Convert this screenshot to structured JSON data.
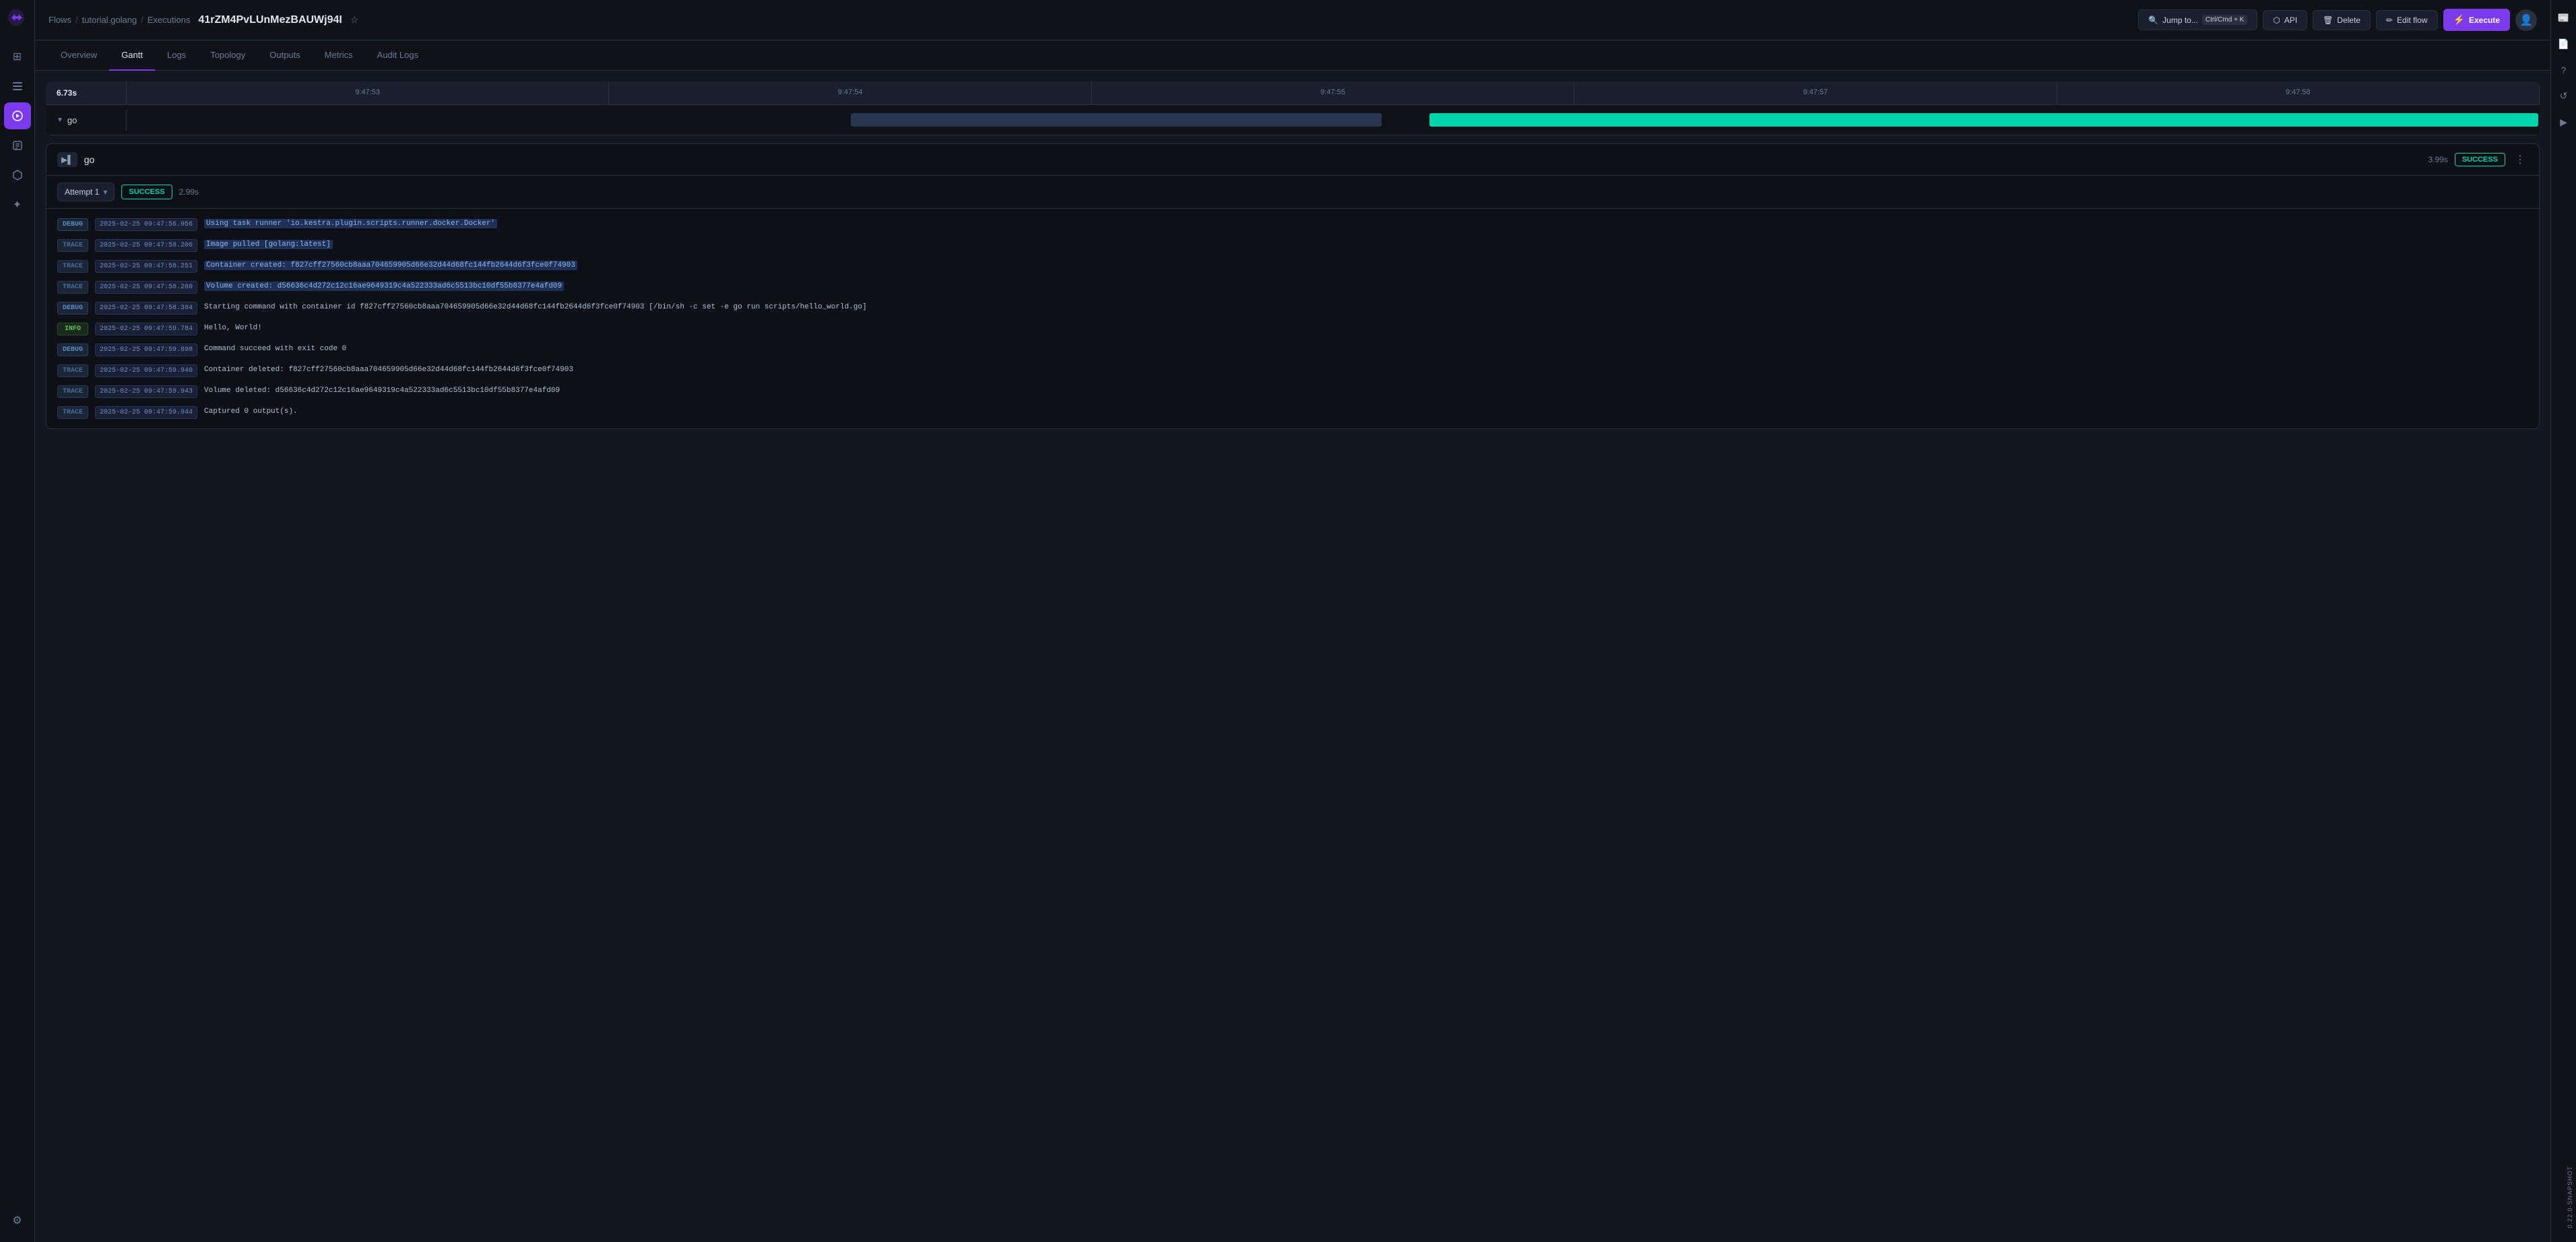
{
  "sidebar": {
    "logo_alt": "Kestra",
    "items": [
      {
        "id": "dashboard",
        "icon": "⊞",
        "label": "Dashboard"
      },
      {
        "id": "flows",
        "icon": "≡",
        "label": "Flows"
      },
      {
        "id": "executions",
        "icon": "▶",
        "label": "Executions",
        "active": true
      },
      {
        "id": "logs",
        "icon": "≣",
        "label": "Logs"
      },
      {
        "id": "plugins",
        "icon": "⬡",
        "label": "Plugins"
      },
      {
        "id": "integrations",
        "icon": "✦",
        "label": "Integrations"
      },
      {
        "id": "settings",
        "icon": "⚙",
        "label": "Settings"
      }
    ]
  },
  "header": {
    "breadcrumb": [
      "Flows",
      "tutorial.golang",
      "Executions"
    ],
    "flow_id": "41rZM4PvLUnMezBAUWj94I",
    "actions": {
      "jump_to": "Jump to...",
      "shortcut": "Ctrl/Cmd + K",
      "api": "API",
      "delete": "Delete",
      "edit_flow": "Edit flow",
      "execute": "Execute"
    }
  },
  "nav_tabs": [
    {
      "id": "overview",
      "label": "Overview"
    },
    {
      "id": "gantt",
      "label": "Gantt",
      "active": true
    },
    {
      "id": "logs",
      "label": "Logs"
    },
    {
      "id": "topology",
      "label": "Topology"
    },
    {
      "id": "outputs",
      "label": "Outputs"
    },
    {
      "id": "metrics",
      "label": "Metrics"
    },
    {
      "id": "audit_logs",
      "label": "Audit Logs"
    }
  ],
  "gantt": {
    "label_col": "6.73s",
    "time_markers": [
      "9:47:53",
      "9:47:54",
      "9:47:55",
      "9:47:57",
      "9:47:58"
    ],
    "row_label": "go"
  },
  "task": {
    "name": "go",
    "icon": "▶▌",
    "duration": "3.99s",
    "status": "SUCCESS",
    "attempt": {
      "label": "Attempt 1",
      "status": "SUCCESS",
      "duration": "2.99s"
    }
  },
  "logs": [
    {
      "level": "DEBUG",
      "level_class": "badge-debug",
      "timestamp": "2025-02-25 09:47:56.956",
      "message": "Using task runner 'io.kestra.plugin.scripts.runner.docker.Docker'",
      "highlighted": true
    },
    {
      "level": "TRACE",
      "level_class": "badge-trace",
      "timestamp": "2025-02-25 09:47:58.206",
      "message": "Image pulled [golang:latest]",
      "highlighted": true
    },
    {
      "level": "TRACE",
      "level_class": "badge-trace",
      "timestamp": "2025-02-25 09:47:58.251",
      "message": "Container created: f827cff27560cb8aaa704659905d66e32d44d68fc144fb2644d6f3fce0f74903",
      "highlighted": true
    },
    {
      "level": "TRACE",
      "level_class": "badge-trace",
      "timestamp": "2025-02-25 09:47:58.260",
      "message": "Volume created: d56636c4d272c12c16ae9649319c4a522333ad6c5513bc10df55b8377e4afd09",
      "highlighted": true
    },
    {
      "level": "DEBUG",
      "level_class": "badge-debug",
      "timestamp": "2025-02-25 09:47:58.384",
      "message": "Starting command with container id f827cff27560cb8aaa704659905d66e32d44d68fc144fb2644d6f3fce0f74903 [/bin/sh -c set -e\ngo run scripts/hello_world.go]",
      "highlighted": false
    },
    {
      "level": "INFO",
      "level_class": "badge-info",
      "timestamp": "2025-02-25 09:47:59.784",
      "message": "Hello, World!",
      "highlighted": false
    },
    {
      "level": "DEBUG",
      "level_class": "badge-debug",
      "timestamp": "2025-02-25 09:47:59.898",
      "message": "Command succeed with exit code 0",
      "highlighted": false
    },
    {
      "level": "TRACE",
      "level_class": "badge-trace",
      "timestamp": "2025-02-25 09:47:59.940",
      "message": "Container deleted: f827cff27560cb8aaa704659905d66e32d44d68fc144fb2644d6f3fce0f74903",
      "highlighted": false
    },
    {
      "level": "TRACE",
      "level_class": "badge-trace",
      "timestamp": "2025-02-25 09:47:59.943",
      "message": "Volume deleted: d56636c4d272c12c16ae9649319c4a522333ad6c5513bc10df55b8377e4afd09",
      "highlighted": false
    },
    {
      "level": "TRACE",
      "level_class": "badge-trace",
      "timestamp": "2025-02-25 09:47:59.944",
      "message": "Captured 0 output(s).",
      "highlighted": false
    }
  ],
  "right_panel": {
    "items": [
      {
        "id": "news",
        "icon": "📰",
        "label": "News"
      },
      {
        "id": "docs",
        "icon": "📄",
        "label": "Docs"
      },
      {
        "id": "help",
        "icon": "?",
        "label": "Help"
      },
      {
        "id": "open-issue",
        "icon": "↺",
        "label": "Open an Issue"
      },
      {
        "id": "get-demo",
        "icon": "▶",
        "label": "Get a demo"
      }
    ],
    "version_label": "0.22.0-SNAPSHOT"
  }
}
